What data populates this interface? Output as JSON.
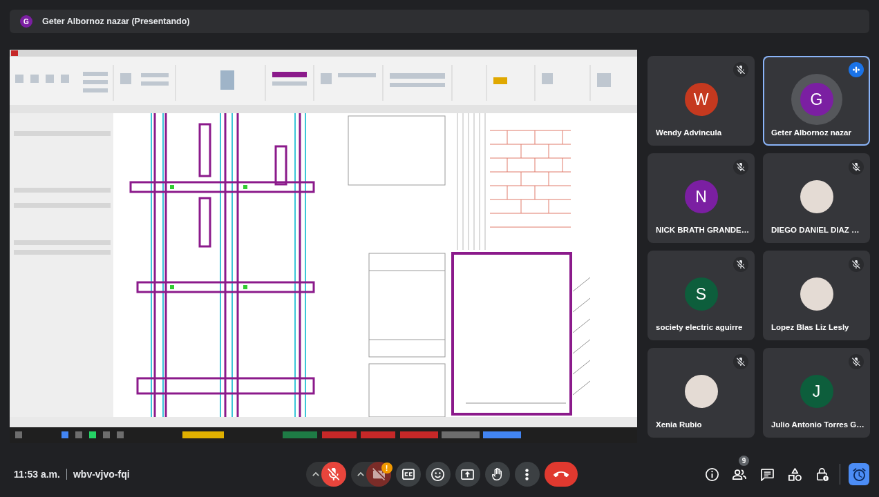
{
  "presenter_banner": {
    "initial": "G",
    "text": "Geter Albornoz nazar (Presentando)"
  },
  "participants": [
    {
      "name": "Wendy Advincula",
      "kind": "initial",
      "initial": "W",
      "color": "#c5391f",
      "muted": true,
      "speaking": false
    },
    {
      "name": "NICK BRATH GRANDE…",
      "kind": "initial",
      "initial": "N",
      "color": "#7b1fa2",
      "muted": true,
      "speaking": false
    },
    {
      "name": "society electric aguirre",
      "kind": "initial",
      "initial": "S",
      "color": "#0d5e3c",
      "muted": true,
      "speaking": false
    },
    {
      "name": "Xenia Rubio",
      "kind": "photo",
      "muted": true,
      "speaking": false
    },
    {
      "name": "Geter Albornoz nazar",
      "kind": "initial",
      "initial": "G",
      "color": "#7b1fa2",
      "muted": false,
      "speaking": true
    },
    {
      "name": "DIEGO DANIEL DIAZ …",
      "kind": "photo",
      "muted": true,
      "speaking": false
    },
    {
      "name": "Lopez Blas Liz Lesly",
      "kind": "photo",
      "muted": true,
      "speaking": false
    },
    {
      "name": "Julio Antonio Torres G…",
      "kind": "initial",
      "initial": "J",
      "color": "#0d5e3c",
      "muted": true,
      "speaking": false
    }
  ],
  "meeting": {
    "time": "11:53 a.m.",
    "code": "wbv-vjvo-fqi"
  },
  "controls": [
    {
      "kind": "mic",
      "on": false,
      "disabled": false
    },
    {
      "kind": "camera",
      "on": false,
      "disabled": true,
      "badge": "!"
    },
    {
      "kind": "captions",
      "on": false
    },
    {
      "kind": "reactions"
    },
    {
      "kind": "present"
    },
    {
      "kind": "raise-hand",
      "on": false
    },
    {
      "kind": "more"
    },
    {
      "kind": "leave"
    }
  ],
  "side_tools": [
    {
      "kind": "info",
      "active": false
    },
    {
      "kind": "people",
      "active": false,
      "badge": "9"
    },
    {
      "kind": "chat",
      "active": false
    },
    {
      "kind": "activities",
      "active": false
    },
    {
      "kind": "host-controls",
      "active": false
    },
    {
      "kind": "timer",
      "active": true
    }
  ]
}
